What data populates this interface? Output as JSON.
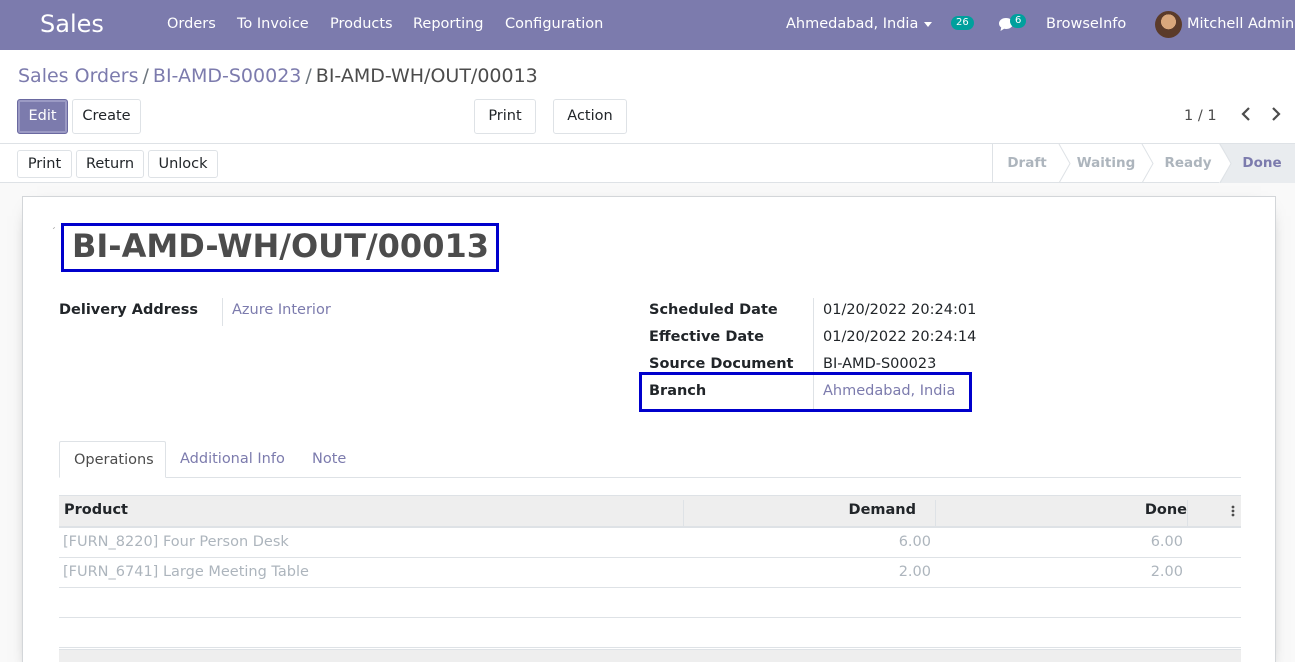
{
  "navbar": {
    "app_name": "Sales",
    "menu": [
      "Orders",
      "To Invoice",
      "Products",
      "Reporting",
      "Configuration"
    ],
    "branch": "Ahmedabad, India",
    "activity_count": "26",
    "message_count": "6",
    "company": "BrowseInfo",
    "user": "Mitchell Admin"
  },
  "breadcrumb": {
    "root": "Sales Orders",
    "parent": "BI-AMD-S00023",
    "current": "BI-AMD-WH/OUT/00013",
    "separator": "/"
  },
  "control": {
    "edit_label": "Edit",
    "create_label": "Create",
    "print_label": "Print",
    "action_label": "Action",
    "pager": "1 / 1"
  },
  "statusbar": {
    "print_label": "Print",
    "return_label": "Return",
    "unlock_label": "Unlock",
    "stages": [
      "Draft",
      "Waiting",
      "Ready",
      "Done"
    ],
    "active_stage": "Done"
  },
  "record": {
    "name": "BI-AMD-WH/OUT/00013",
    "delivery_address_label": "Delivery Address",
    "delivery_address": "Azure Interior",
    "scheduled_date_label": "Scheduled Date",
    "scheduled_date": "01/20/2022 20:24:01",
    "effective_date_label": "Effective Date",
    "effective_date": "01/20/2022 20:24:14",
    "source_document_label": "Source Document",
    "source_document": "BI-AMD-S00023",
    "branch_label": "Branch",
    "branch": "Ahmedabad, India"
  },
  "tabs": [
    "Operations",
    "Additional Info",
    "Note"
  ],
  "operations": {
    "columns": [
      "Product",
      "Demand",
      "Done"
    ],
    "rows": [
      {
        "product": "[FURN_8220] Four Person Desk",
        "demand": "6.00",
        "done": "6.00"
      },
      {
        "product": "[FURN_6741] Large Meeting Table",
        "demand": "2.00",
        "done": "2.00"
      }
    ]
  },
  "colors": {
    "navbar": "#7c7bad",
    "highlight_box": "#0000cc",
    "badge": "#00a09d"
  }
}
